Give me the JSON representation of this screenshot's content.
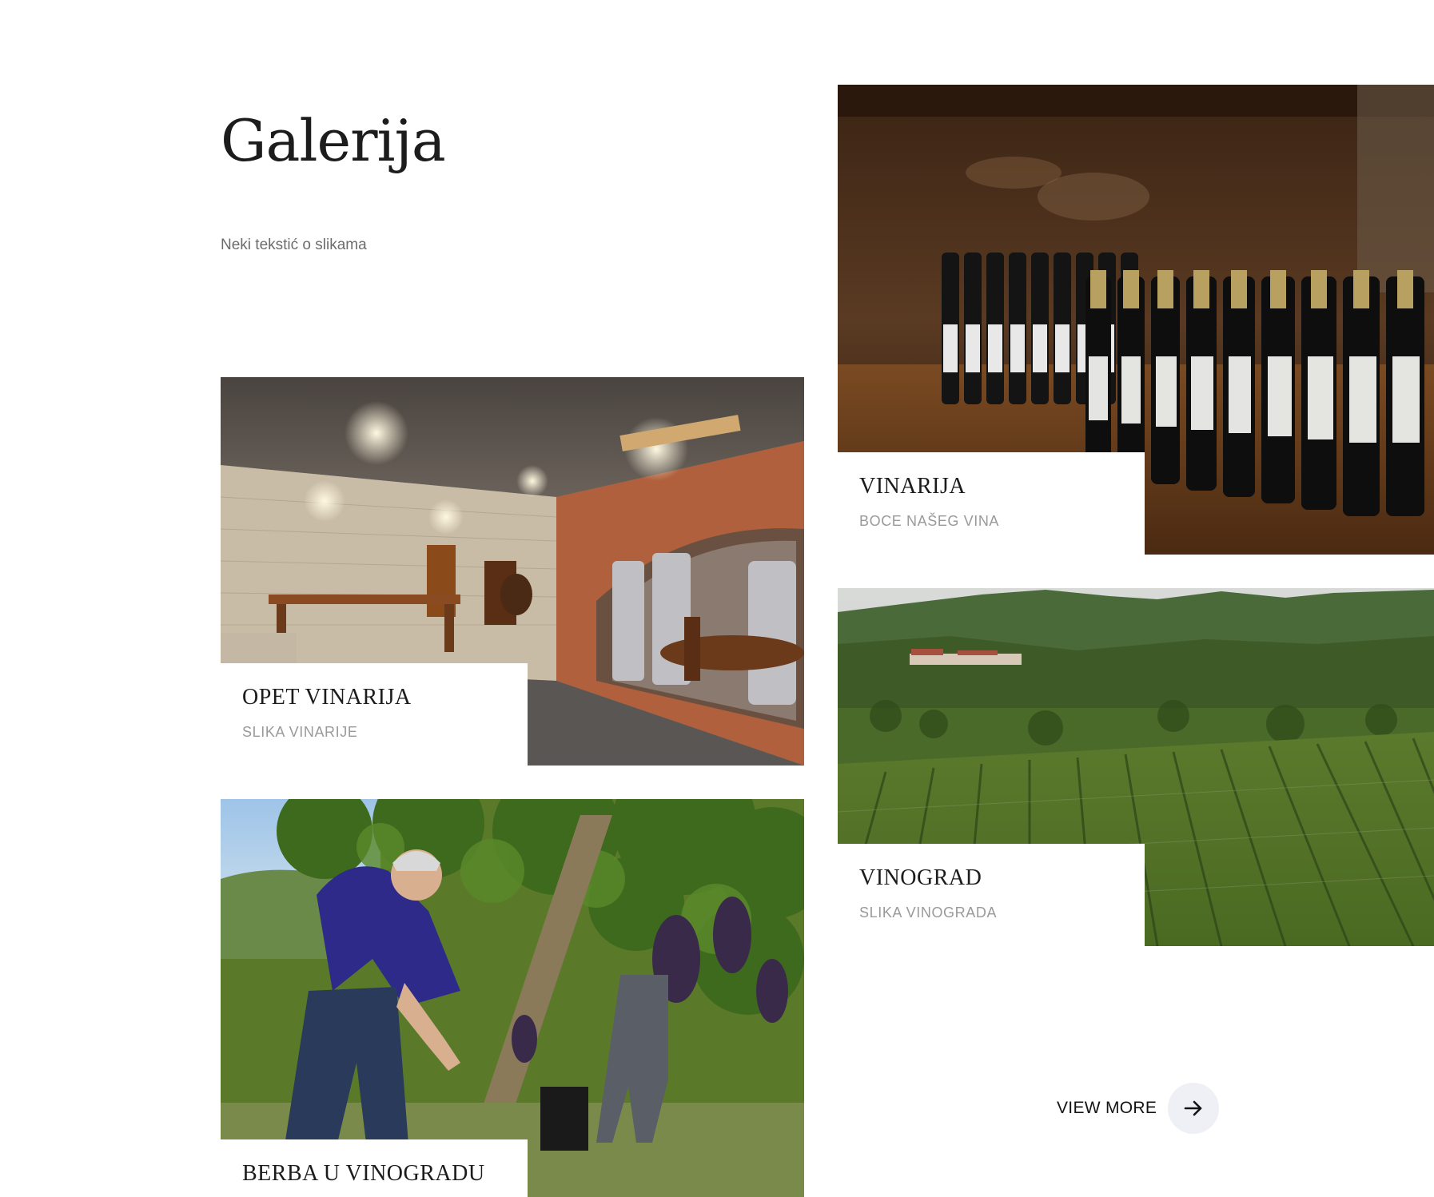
{
  "header": {
    "title": "Galerija",
    "subtitle": "Neki tekstić o slikama"
  },
  "gallery": [
    {
      "title": "VINARIJA",
      "subtitle": "BOCE NAŠEG VINA",
      "image_subject": "wine-bottles-photo"
    },
    {
      "title": "OPET VINARIJA",
      "subtitle": "SLIKA VINARIJE",
      "image_subject": "winery-cellar-photo"
    },
    {
      "title": "VINOGRAD",
      "subtitle": "SLIKA VINOGRADA",
      "image_subject": "vineyard-landscape-photo"
    },
    {
      "title": "BERBA U VINOGRADU",
      "subtitle": "",
      "image_subject": "grape-harvest-photo"
    }
  ],
  "view_more": {
    "label": "VIEW MORE",
    "icon": "arrow-right-icon"
  },
  "colors": {
    "text_dark": "#1c1c1c",
    "text_muted": "#9a9a9a",
    "button_circle": "#eef0f5"
  }
}
